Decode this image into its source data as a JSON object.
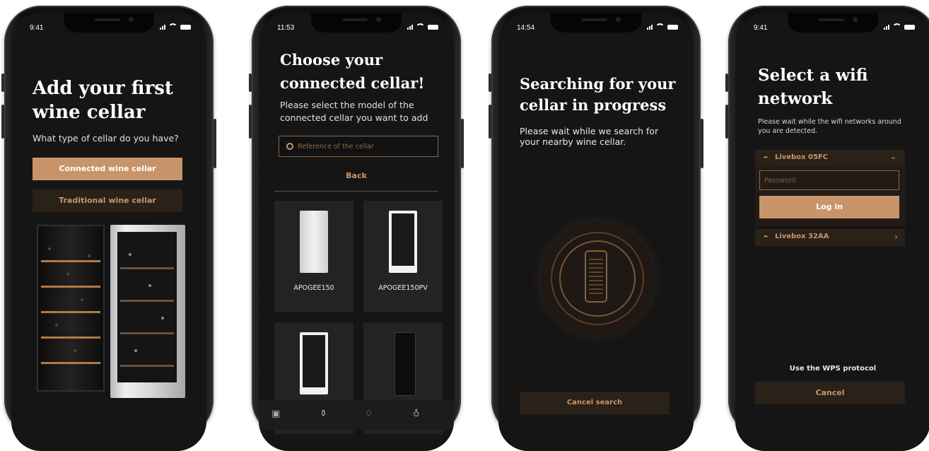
{
  "status_times": [
    "9:41",
    "11:53",
    "14:54",
    "9:41"
  ],
  "screen1": {
    "title": "Add your first wine cellar",
    "subtitle": "What type of cellar do you have?",
    "connected_label": "Connected wine cellar",
    "traditional_label": "Traditional wine cellar"
  },
  "screen2": {
    "title": "Choose your connected cellar!",
    "subtitle": "Please select the model of the connected cellar you want to add",
    "search_placeholder": "Reference of the cellar",
    "back_label": "Back",
    "models": [
      "APOGEE150",
      "APOGEE150PV",
      "",
      ""
    ],
    "tab_icons": [
      "cellar-icon",
      "bottle-icon",
      "bell-icon",
      "profile-icon"
    ]
  },
  "screen3": {
    "title": "Searching for your cellar in progress",
    "subtitle": "Please wait while we search for your nearby wine cellar.",
    "cancel_label": "Cancel search"
  },
  "screen4": {
    "title": "Select a wifi network",
    "subtitle": "Please wait while the wifi networks around you are detected.",
    "network_1": "Livebox 05FC",
    "password_placeholder": "Password",
    "login_label": "Log in",
    "network_2": "Livebox 32AA",
    "wps_label": "Use the WPS protocol",
    "cancel_label": "Cancel"
  },
  "colors": {
    "accent": "#c8956a",
    "background": "#151515",
    "dark_button": "#2a2119"
  }
}
